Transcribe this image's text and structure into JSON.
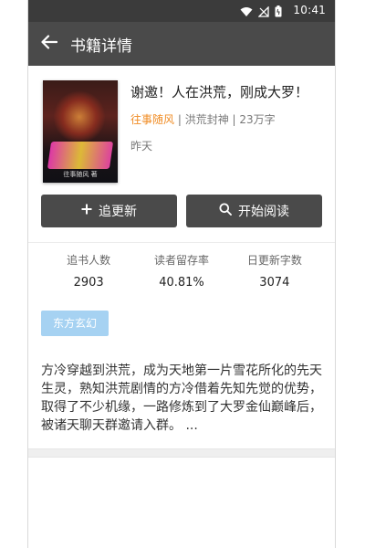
{
  "status_bar": {
    "time": "10:41",
    "icons": [
      "wifi-icon",
      "signal-off-icon",
      "battery-icon"
    ]
  },
  "app_bar": {
    "title": "书籍详情"
  },
  "book": {
    "title": "谢邀！人在洪荒，刚成大罗！",
    "author": "往事随风",
    "category": "洪荒封神",
    "word_count": "23万字",
    "updated": "昨天",
    "cover_subtitle": "往事随风 著"
  },
  "actions": {
    "follow_label": "追更新",
    "read_label": "开始阅读"
  },
  "stats": [
    {
      "label": "追书人数",
      "value": "2903"
    },
    {
      "label": "读者留存率",
      "value": "40.81%"
    },
    {
      "label": "日更新字数",
      "value": "3074"
    }
  ],
  "tags": [
    "东方玄幻"
  ],
  "description": "方冷穿越到洪荒，成为天地第一片雪花所化的先天生灵，熟知洪荒剧情的方冷借着先知先觉的优势，取得了不少机缘，一路修炼到了大罗金仙巅峰后，被诸天聊天群邀请入群。 ...",
  "colors": {
    "appbar": "#4a4a4a",
    "statusbar": "#3b3b3b",
    "author_accent": "#f08c24",
    "tag_bg": "#a6d2f2"
  }
}
